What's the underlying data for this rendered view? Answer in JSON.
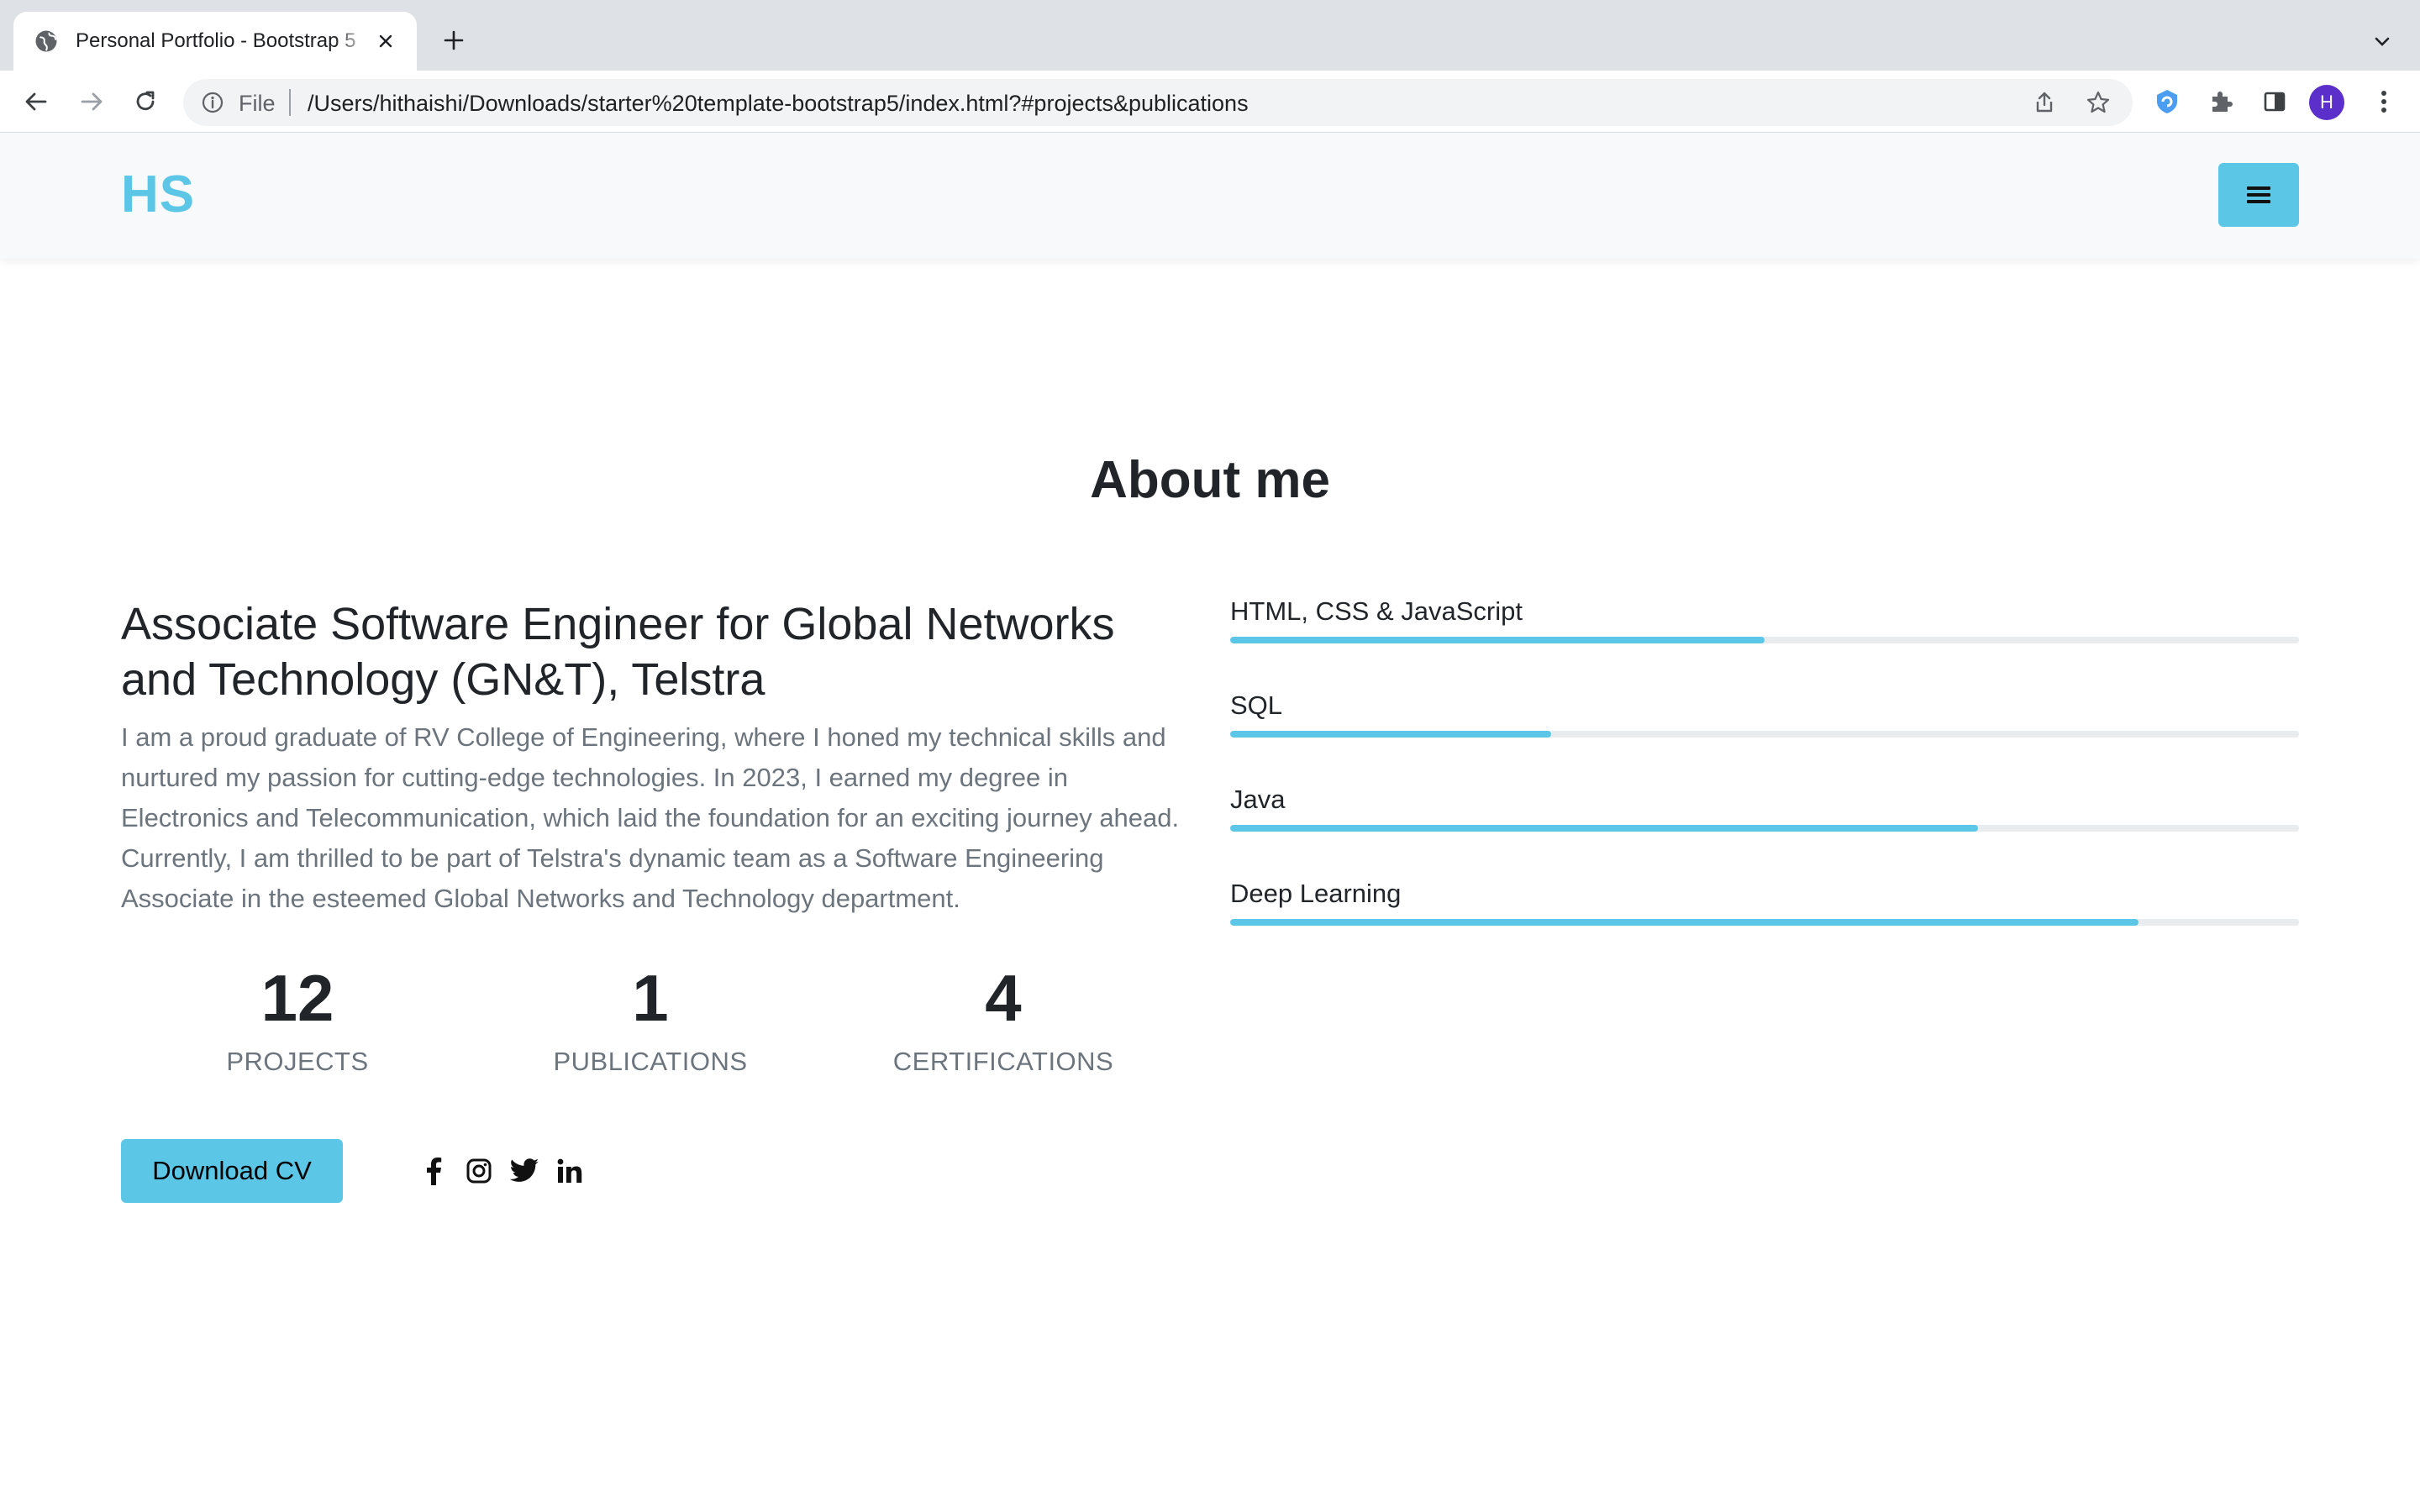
{
  "browser": {
    "tab_title": "Personal Portfolio - Bootstrap 5",
    "url_scheme": "File",
    "url": "/Users/hithaishi/Downloads/starter%20template-bootstrap5/index.html?#projects&publications",
    "profile_initial": "H"
  },
  "navbar": {
    "brand": "HS"
  },
  "about": {
    "title": "About me",
    "job_title": "Associate Software Engineer for Global Networks and Technology (GN&T), Telstra",
    "bio": "I am a proud graduate of RV College of Engineering, where I honed my technical skills and nurtured my passion for cutting-edge technologies. In 2023, I earned my degree in Electronics and Telecommunication, which laid the foundation for an exciting journey ahead. Currently, I am thrilled to be part of Telstra's dynamic team as a Software Engineering Associate in the esteemed Global Networks and Technology department.",
    "stats": [
      {
        "number": "12",
        "label": "PROJECTS"
      },
      {
        "number": "1",
        "label": "PUBLICATIONS"
      },
      {
        "number": "4",
        "label": "CERTIFICATIONS"
      }
    ],
    "cv_button": "Download CV",
    "socials": [
      "facebook-icon",
      "instagram-icon",
      "twitter-icon",
      "linkedin-icon"
    ]
  },
  "skills": [
    {
      "name": "HTML, CSS & JavaScript",
      "percent": 50
    },
    {
      "name": "SQL",
      "percent": 30
    },
    {
      "name": "Java",
      "percent": 70
    },
    {
      "name": "Deep Learning",
      "percent": 85
    }
  ],
  "colors": {
    "accent": "#5bc6e6",
    "track": "#e9ecef",
    "muted_text": "#6c757d"
  }
}
